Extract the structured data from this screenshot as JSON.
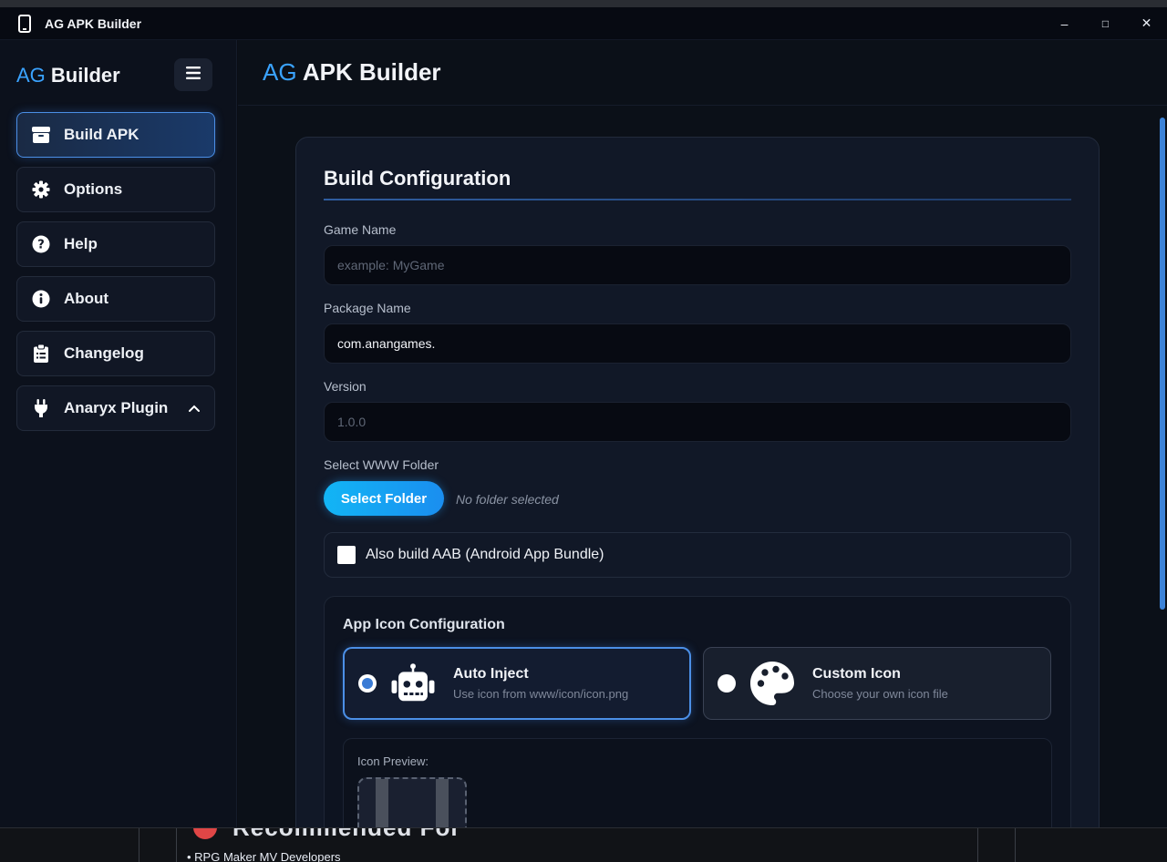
{
  "window": {
    "title": "AG APK Builder",
    "controls": {
      "minimize": "–",
      "maximize": "□",
      "close": "✕"
    }
  },
  "sidebar": {
    "brand_prefix": "AG",
    "brand_name": "Builder",
    "items": [
      {
        "label": "Build APK",
        "icon": "box-icon",
        "active": true
      },
      {
        "label": "Options",
        "icon": "gear-icon"
      },
      {
        "label": "Help",
        "icon": "question-icon"
      },
      {
        "label": "About",
        "icon": "info-icon"
      },
      {
        "label": "Changelog",
        "icon": "clipboard-icon"
      },
      {
        "label": "Anaryx Plugin",
        "icon": "plug-icon",
        "expandable": true
      }
    ]
  },
  "header": {
    "title_prefix": "AG",
    "title": "APK Builder"
  },
  "form": {
    "title": "Build Configuration",
    "game_name": {
      "label": "Game Name",
      "value": "",
      "placeholder": "example: MyGame"
    },
    "package_name": {
      "label": "Package Name",
      "value": "com.anangames.",
      "placeholder": ""
    },
    "version": {
      "label": "Version",
      "value": "",
      "placeholder": "1.0.0"
    },
    "www_folder": {
      "label": "Select WWW Folder",
      "button": "Select Folder",
      "status": "No folder selected"
    },
    "aab": {
      "label": "Also build AAB (Android App Bundle)",
      "checked": false
    }
  },
  "icon_config": {
    "title": "App Icon Configuration",
    "options": [
      {
        "title": "Auto Inject",
        "subtitle": "Use icon from www/icon/icon.png",
        "selected": true,
        "icon": "robot-icon"
      },
      {
        "title": "Custom Icon",
        "subtitle": "Choose your own icon file",
        "selected": false,
        "icon": "palette-icon"
      }
    ],
    "preview_label": "Icon Preview:"
  },
  "background": {
    "list_item": "• RPG Maker MV Developers",
    "heading": "Recommended For"
  },
  "colors": {
    "accent": "#3aa3ff",
    "active_border": "#4b8fe6",
    "button_gradient_start": "#12b5f5",
    "button_gradient_end": "#1a8ef0"
  }
}
